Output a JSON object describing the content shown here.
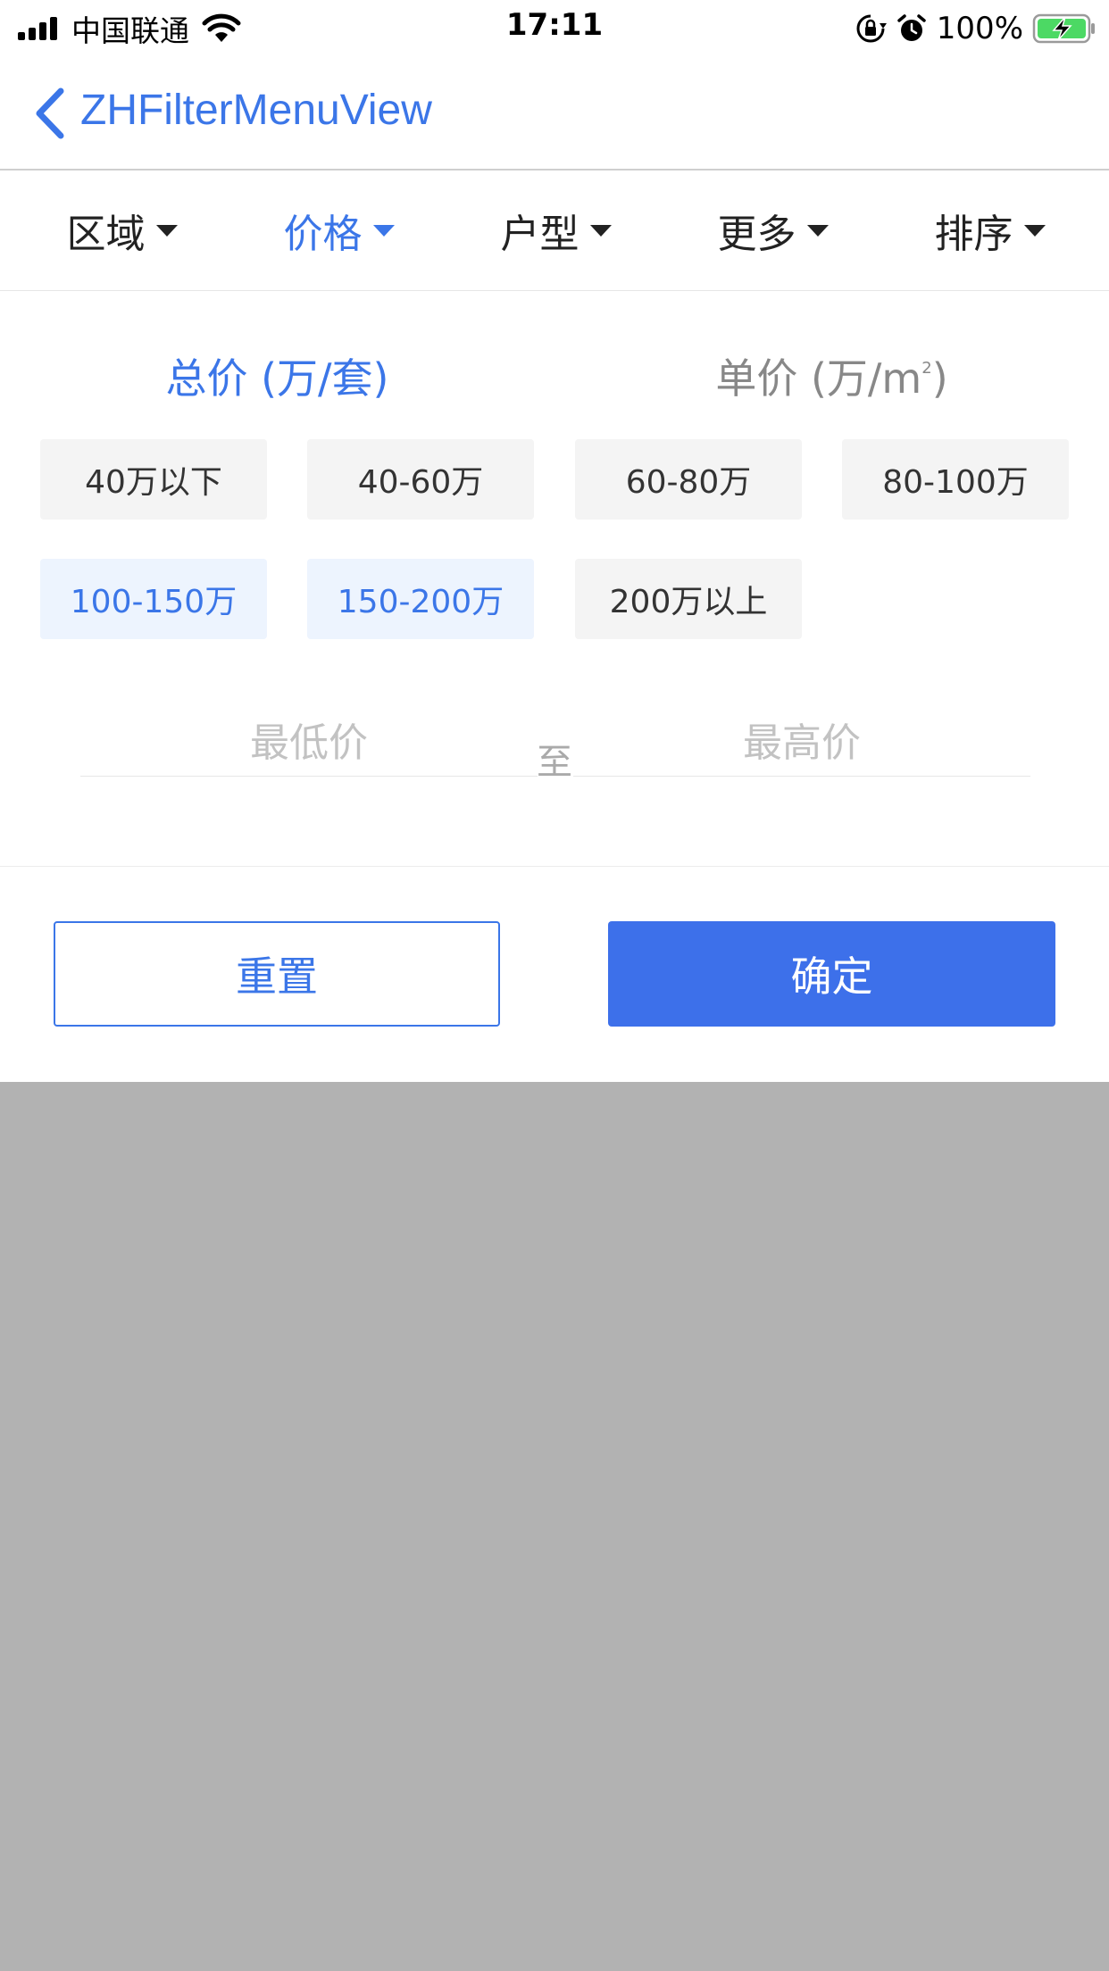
{
  "status_bar": {
    "carrier": "中国联通",
    "time": "17:11",
    "battery": "100%"
  },
  "nav": {
    "title": "ZHFilterMenuView"
  },
  "tabs": [
    {
      "label": "区域"
    },
    {
      "label": "价格"
    },
    {
      "label": "户型"
    },
    {
      "label": "更多"
    },
    {
      "label": "排序"
    }
  ],
  "price_panel": {
    "segments": {
      "total": "总价 (万/套)",
      "unit_prefix": "单价 (万/m",
      "unit_sup": "2",
      "unit_suffix": ")"
    },
    "options": [
      {
        "label": "40万以下",
        "selected": false
      },
      {
        "label": "40-60万",
        "selected": false
      },
      {
        "label": "60-80万",
        "selected": false
      },
      {
        "label": "80-100万",
        "selected": false
      },
      {
        "label": "100-150万",
        "selected": true
      },
      {
        "label": "150-200万",
        "selected": true
      },
      {
        "label": "200万以上",
        "selected": false
      }
    ],
    "min_placeholder": "最低价",
    "to_label": "至",
    "max_placeholder": "最高价"
  },
  "actions": {
    "reset": "重置",
    "confirm": "确定"
  },
  "colors": {
    "accent": "#3b76e8",
    "confirm_bg": "#3d70ea",
    "chip_bg": "#f4f4f4",
    "chip_selected_bg": "#edf4fe",
    "overlay": "#b2b2b2"
  }
}
